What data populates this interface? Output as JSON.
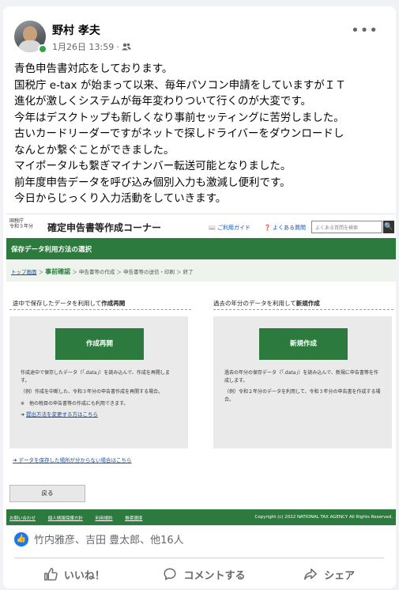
{
  "post": {
    "author": "野村 孝夫",
    "timestamp": "1月26日 13:59",
    "audience_icon": "friends-icon",
    "more_label": "•••",
    "lines": [
      "青色申告書対応をしております。",
      "国税庁 e-tax が始まって以来、毎年パソコン申請をしていますがＩＴ",
      "進化が激しくシステムが毎年変わりついて行くのが大変です。",
      "今年はデスクトップも新しくなり事前セッティングに苦労しました。",
      "古いカードリーダーですがネットで探しドライバーをダウンロードし",
      "なんとか繋ぐことができました。",
      "マイポータルも繋ぎマイナンバー転送可能となりました。",
      "前年度申告データを呼び込み個別入力も激減し便利です。",
      "今日からじっくり入力活動をしていきます。"
    ]
  },
  "screenshot": {
    "logo_line1": "国税庁",
    "logo_line2": "令和３年分",
    "title": "確定申告書等作成コーナー",
    "guide_link": "ご利用ガイド",
    "faq_link": "よくある質問",
    "search_placeholder": "よくある質問を検索",
    "search_button": "🔍",
    "section_title": "保存データ利用方法の選択",
    "crumbs": {
      "top": "トップ画面",
      "arrow1": "＞",
      "current": "事前確認",
      "arrow2": "＞",
      "step2": "申告書等の作成",
      "arrow3": "＞",
      "step3": "申告書等の送信・印刷",
      "arrow4": "＞",
      "step4": "終了"
    },
    "left_panel": {
      "heading_prefix": "途中で保存したデータを利用して",
      "heading_bold": "作成再開",
      "button": "作成再開",
      "desc1": "作成途中で保存したデータ（「.data」）を読み込んで、作成を再開します。",
      "desc2": "（例）作成を中断した、令和３年分の申告書作成を再開する場合。",
      "desc3": "※　他の税目の申告書等の作成にも利用できます。",
      "link": "提出方法を変更する方はこちら"
    },
    "right_panel": {
      "heading_prefix": "過去の年分のデータを利用して",
      "heading_bold": "新規作成",
      "button": "新規作成",
      "desc1": "過去の年分の保存データ（「.data」）を読み込んで、新規に申告書等を作成します。",
      "desc2": "（例）令和２年分のデータを利用して、令和３年分の申告書を作成する場合。"
    },
    "data_link": "データを保存した場所が分からない場合はこちら",
    "back_button": "戻る",
    "footer_links": [
      "お問い合わせ",
      "個人情報保護方針",
      "利用規約",
      "推奨環境"
    ],
    "copyright": "Copyright (c) 2022 NATIONAL TAX AGENCY All Rights Reserved."
  },
  "reactions": {
    "text": "竹内雅彦、吉田 豊太郎、他16人"
  },
  "actions": {
    "like": "いいね！",
    "comment": "コメントする",
    "share": "シェア"
  }
}
